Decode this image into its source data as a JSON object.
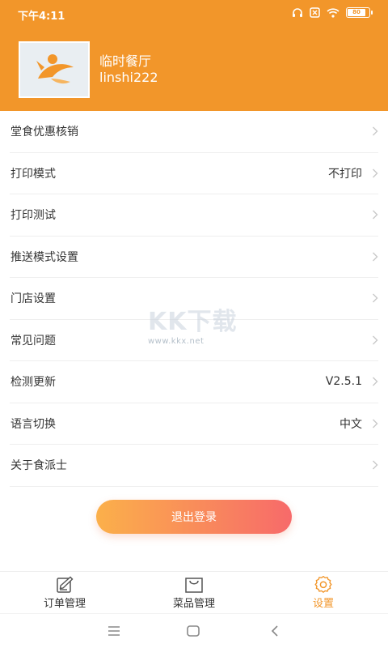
{
  "status_bar": {
    "time": "下午4:11",
    "battery": "80"
  },
  "profile": {
    "shop_name": "临时餐厅",
    "account": "linshi222"
  },
  "menu": {
    "items": [
      {
        "label": "堂食优惠核销",
        "value": ""
      },
      {
        "label": "打印模式",
        "value": "不打印"
      },
      {
        "label": "打印测试",
        "value": ""
      },
      {
        "label": "推送模式设置",
        "value": ""
      },
      {
        "label": "门店设置",
        "value": ""
      },
      {
        "label": "常见问题",
        "value": ""
      },
      {
        "label": "检测更新",
        "value": "V2.5.1"
      },
      {
        "label": "语言切换",
        "value": "中文"
      },
      {
        "label": "关于食派士",
        "value": ""
      }
    ]
  },
  "logout_label": "退出登录",
  "watermark": {
    "text": "KK下载",
    "url": "www.kkx.net"
  },
  "tabbar": {
    "tabs": [
      {
        "label": "订单管理",
        "icon": "edit-icon"
      },
      {
        "label": "菜品管理",
        "icon": "shopping-bag-icon"
      },
      {
        "label": "设置",
        "icon": "gear-icon"
      }
    ],
    "active_index": 2
  },
  "colors": {
    "accent": "#f2962a",
    "logout_start": "#fbb04a",
    "logout_end": "#f76a6a"
  }
}
